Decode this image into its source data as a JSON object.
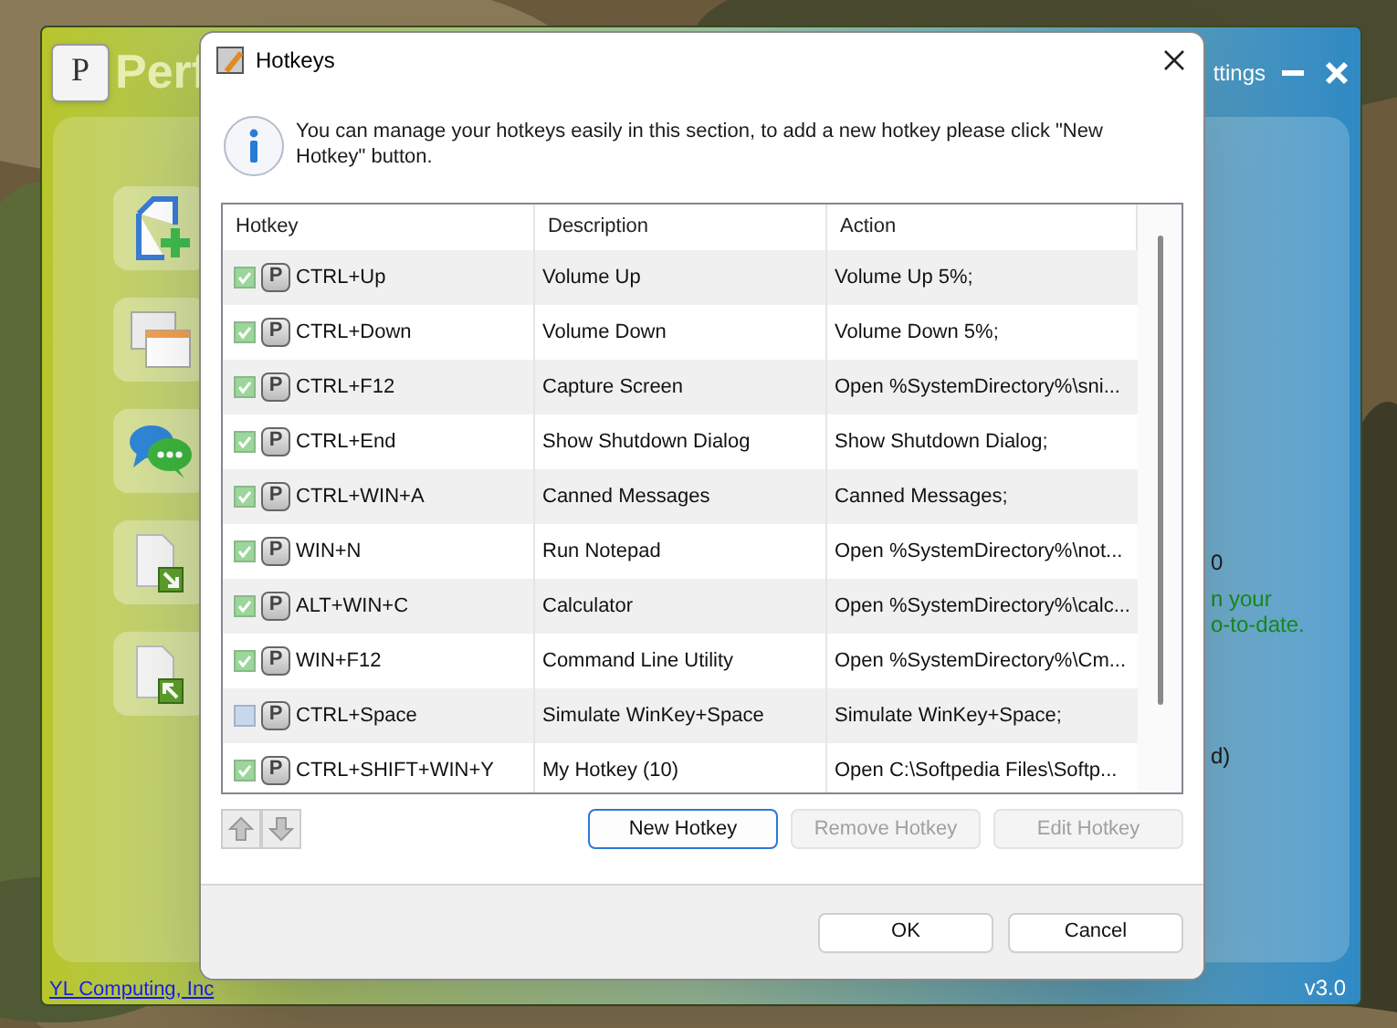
{
  "main_window": {
    "logo_key": "P",
    "title": "Perf",
    "settings_link": "ttings",
    "side_texts": [
      {
        "text": "0",
        "kind": "plain"
      },
      {
        "text": "n your",
        "kind": "status"
      },
      {
        "text": "o-to-date.",
        "kind": "status"
      },
      {
        "text": "d)",
        "kind": "plain"
      }
    ],
    "company_link": "YL Computing, Inc",
    "version": "v3.0"
  },
  "dialog": {
    "title": "Hotkeys",
    "info": "You can manage your hotkeys easily in this section, to add a new hotkey please click \"New Hotkey\" button.",
    "table": {
      "columns": [
        "Hotkey",
        "Description",
        "Action"
      ],
      "rows": [
        {
          "checked": true,
          "key_badge": "P",
          "hotkey": "CTRL+Up",
          "description": "Volume Up",
          "action": "Volume Up 5%;"
        },
        {
          "checked": true,
          "key_badge": "P",
          "hotkey": "CTRL+Down",
          "description": "Volume Down",
          "action": "Volume Down 5%;"
        },
        {
          "checked": true,
          "key_badge": "P",
          "hotkey": "CTRL+F12",
          "description": "Capture Screen",
          "action": "Open %SystemDirectory%\\sni..."
        },
        {
          "checked": true,
          "key_badge": "P",
          "hotkey": "CTRL+End",
          "description": "Show Shutdown Dialog",
          "action": "Show Shutdown Dialog;"
        },
        {
          "checked": true,
          "key_badge": "P",
          "hotkey": "CTRL+WIN+A",
          "description": "Canned Messages",
          "action": "Canned Messages;"
        },
        {
          "checked": true,
          "key_badge": "P",
          "hotkey": "WIN+N",
          "description": "Run Notepad",
          "action": "Open %SystemDirectory%\\not..."
        },
        {
          "checked": true,
          "key_badge": "P",
          "hotkey": "ALT+WIN+C",
          "description": "Calculator",
          "action": "Open %SystemDirectory%\\calc..."
        },
        {
          "checked": true,
          "key_badge": "P",
          "hotkey": "WIN+F12",
          "description": "Command Line Utility",
          "action": "Open %SystemDirectory%\\Cm..."
        },
        {
          "checked": false,
          "key_badge": "P",
          "hotkey": "CTRL+Space",
          "description": "Simulate WinKey+Space",
          "action": "Simulate WinKey+Space;"
        },
        {
          "checked": true,
          "key_badge": "P",
          "hotkey": "CTRL+SHIFT+WIN+Y",
          "description": "My Hotkey (10)",
          "action": "Open C:\\Softpedia Files\\Softp..."
        }
      ]
    },
    "actions": [
      {
        "label": "New Hotkey",
        "disabled": false
      },
      {
        "label": "Remove Hotkey",
        "disabled": true
      },
      {
        "label": "Edit Hotkey",
        "disabled": true
      }
    ],
    "footer_buttons": [
      "OK",
      "Cancel"
    ]
  }
}
